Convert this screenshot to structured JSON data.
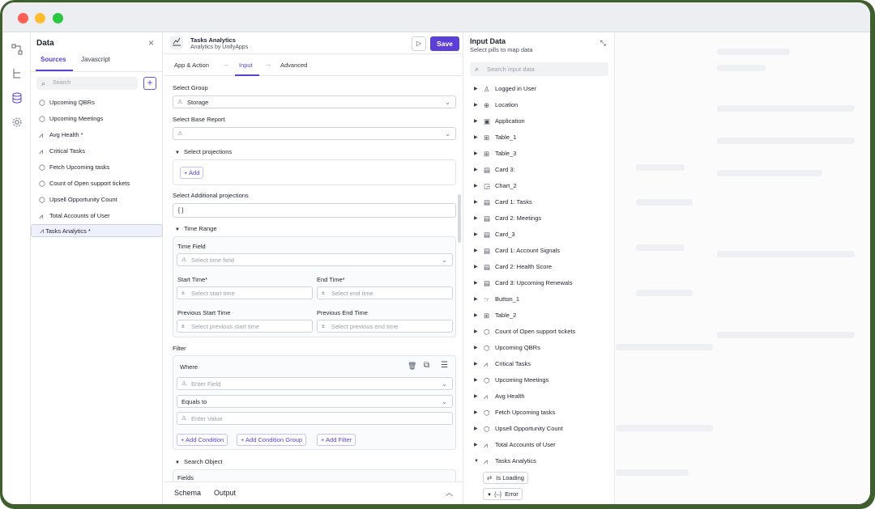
{
  "window": {
    "controls": [
      "close",
      "minimize",
      "zoom"
    ]
  },
  "rail": {
    "icons": [
      "flow-icon",
      "tree-icon",
      "database-icon",
      "gear-icon"
    ]
  },
  "data_panel": {
    "title": "Data",
    "close_glyph": "×",
    "tabs": [
      {
        "label": "Sources",
        "active": true
      },
      {
        "label": "Javascript",
        "active": false
      }
    ],
    "search_placeholder": "Search",
    "add_glyph": "+",
    "sources": [
      {
        "label": "Upcoming QBRs",
        "icon": "cube-icon"
      },
      {
        "label": "Upcoming Meetings",
        "icon": "cube-icon"
      },
      {
        "label": "Avg Health *",
        "icon": "chart-icon"
      },
      {
        "label": "Critical Tasks",
        "icon": "chart-icon"
      },
      {
        "label": "Fetch Upcoming tasks",
        "icon": "cube-icon"
      },
      {
        "label": "Count of Open support tickets",
        "icon": "cube-icon"
      },
      {
        "label": "Upsell Opportunity Count",
        "icon": "cube-icon"
      },
      {
        "label": "Total Accounts of User",
        "icon": "chart-icon"
      },
      {
        "label": "Tasks Analytics *",
        "icon": "chart-icon",
        "selected": true
      }
    ]
  },
  "editor": {
    "app_title": "Tasks Analytics",
    "app_subtitle": "Analytics by UnifyApps",
    "run_glyph": "▷",
    "save_label": "Save",
    "steps": [
      {
        "label": "App & Action",
        "active": false
      },
      {
        "label": "Input",
        "active": true
      },
      {
        "label": "Advanced",
        "active": false
      }
    ],
    "select_group_label": "Select Group",
    "select_group_value": "Storage",
    "base_report_label": "Select Base Report",
    "base_report_value": "",
    "projections_label": "Select projections",
    "add_label": "+ Add",
    "additional_projections_label": "Select Additional projections",
    "additional_projections_value": "[ ]",
    "time_range_label": "Time Range",
    "time_field_label": "Time Field",
    "time_field_placeholder": "Select time field",
    "start_time_label": "Start Time*",
    "start_time_placeholder": "Select start time",
    "end_time_label": "End Time*",
    "end_time_placeholder": "Select end time",
    "prev_start_label": "Previous Start Time",
    "prev_start_placeholder": "Select previous start time",
    "prev_end_label": "Previous End Time",
    "prev_end_placeholder": "Select previous end time",
    "filter_label": "Filter",
    "where_label": "Where",
    "enter_field_placeholder": "Enter Field",
    "operator_value": "Equals to",
    "enter_value_placeholder": "Enter Value",
    "add_condition": "+ Add Condition",
    "add_condition_group": "+ Add Condition Group",
    "add_filter": "+ Add Filter",
    "search_object_label": "Search Object",
    "fields_label": "Fields",
    "footer_tabs": [
      "Schema",
      "Output"
    ],
    "footer_toggle": "︿"
  },
  "input_data": {
    "title": "Input Data",
    "subtitle": "Select pills to map data",
    "collapse_glyph": "⤡",
    "search_placeholder": "Search input data",
    "items": [
      {
        "label": "Logged in User",
        "icon": "user-icon"
      },
      {
        "label": "Location",
        "icon": "globe-icon"
      },
      {
        "label": "Application",
        "icon": "window-icon"
      },
      {
        "label": "Table_1",
        "icon": "table-icon"
      },
      {
        "label": "Table_3",
        "icon": "table-icon"
      },
      {
        "label": "Card 3:",
        "icon": "card-icon"
      },
      {
        "label": "Chart_2",
        "icon": "chart-icon"
      },
      {
        "label": "Card 1: Tasks",
        "icon": "card-icon"
      },
      {
        "label": "Card 2: Meetings",
        "icon": "card-icon"
      },
      {
        "label": "Card_3",
        "icon": "card-icon"
      },
      {
        "label": "Card 1: Account Signals",
        "icon": "card-icon"
      },
      {
        "label": "Card 2: Health Score",
        "icon": "card-icon"
      },
      {
        "label": "Card 3: Upcoming Renewals",
        "icon": "card-icon"
      },
      {
        "label": "Button_1",
        "icon": "button-icon"
      },
      {
        "label": "Table_2",
        "icon": "table-icon"
      },
      {
        "label": "Count of Open support tickets",
        "icon": "cube-icon"
      },
      {
        "label": "Upcoming QBRs",
        "icon": "cube-icon"
      },
      {
        "label": "Critical Tasks",
        "icon": "chart-icon"
      },
      {
        "label": "Upcoming Meetings",
        "icon": "cube-icon"
      },
      {
        "label": "Avg Health",
        "icon": "chart-icon"
      },
      {
        "label": "Fetch Upcoming tasks",
        "icon": "cube-icon"
      },
      {
        "label": "Upsell Opportunity Count",
        "icon": "cube-icon"
      },
      {
        "label": "Total Accounts of User",
        "icon": "chart-icon"
      },
      {
        "label": "Tasks Analytics",
        "icon": "chart-icon",
        "expanded": true
      }
    ],
    "children": [
      {
        "label": "Is Loading",
        "icon": "toggle-icon"
      },
      {
        "label": "Error",
        "icon": "object-icon"
      }
    ]
  },
  "colors": {
    "accent": "#5b3fd6",
    "frame": "#3f5f2e"
  }
}
